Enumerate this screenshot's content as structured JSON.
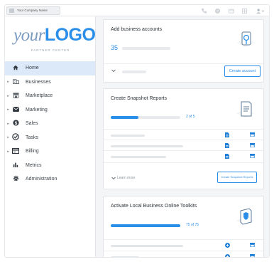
{
  "topbar": {
    "company_name": "Your Company Name",
    "icons": [
      "phone-icon",
      "help-icon",
      "card-icon",
      "grid-icon",
      "user-icon"
    ]
  },
  "sidebar": {
    "logo_your": "your",
    "logo_logo": "LOGO",
    "partner_center": "PARTNER CENTER",
    "items": [
      {
        "label": "Home",
        "icon": "home-icon",
        "expandable": false,
        "active": true
      },
      {
        "label": "Businesses",
        "icon": "building-icon",
        "expandable": true
      },
      {
        "label": "Marketplace",
        "icon": "store-icon",
        "expandable": true
      },
      {
        "label": "Marketing",
        "icon": "mail-icon",
        "expandable": true
      },
      {
        "label": "Sales",
        "icon": "dollar-icon",
        "expandable": true
      },
      {
        "label": "Tasks",
        "icon": "check-circle-icon",
        "expandable": true
      },
      {
        "label": "Billing",
        "icon": "billing-icon",
        "expandable": true
      },
      {
        "label": "Metrics",
        "icon": "bar-chart-icon",
        "expandable": false
      },
      {
        "label": "Administration",
        "icon": "gear-icon",
        "expandable": false
      }
    ]
  },
  "cards": {
    "add_business": {
      "title": "Add business accounts",
      "count": "35",
      "button": "Create account"
    },
    "snapshot": {
      "title": "Create Snapshot Reports",
      "progress_text": "2 of 5",
      "progress_fraction": 0.4,
      "learn_more": "Learn more",
      "button": "Create Snapshot Reports"
    },
    "toolkits": {
      "title": "Activate Local Business Online Toolkits",
      "progress_text": "75 of 75",
      "progress_fraction": 1.0
    }
  },
  "colors": {
    "accent": "#2b8ee8",
    "active_nav": "#dbe9f8"
  }
}
